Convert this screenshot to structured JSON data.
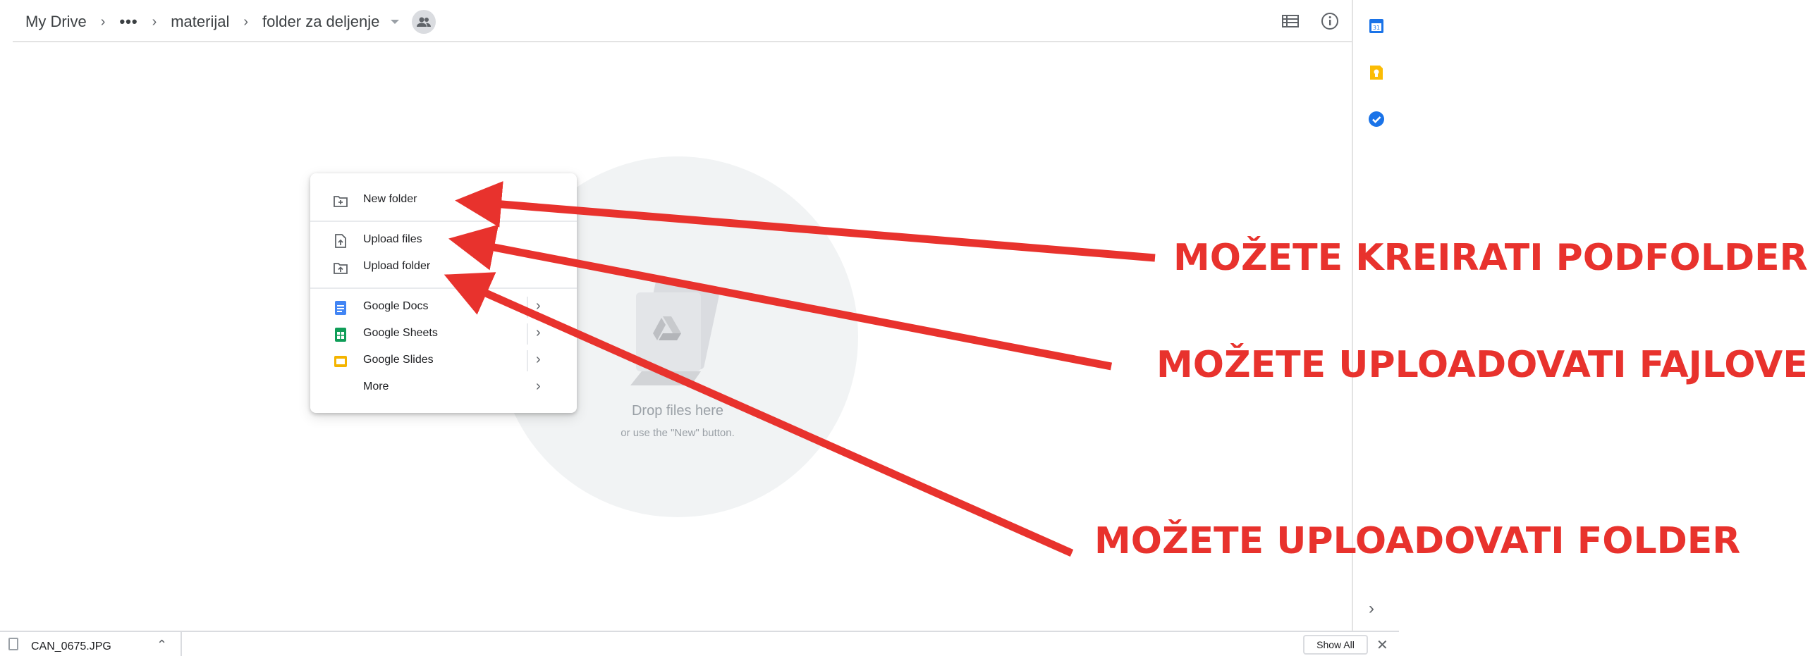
{
  "breadcrumb": {
    "root": "My Drive",
    "more": "•••",
    "folder1": "materijal",
    "current": "folder za deljenje"
  },
  "header_icons": [
    "list-view-icon",
    "info-icon"
  ],
  "side_panel_icons": [
    "calendar-icon",
    "keep-icon",
    "tasks-icon",
    "chevron-right-icon"
  ],
  "menu": {
    "new_folder": "New folder",
    "upload_files": "Upload files",
    "upload_folder": "Upload folder",
    "google_docs": "Google Docs",
    "google_sheets": "Google Sheets",
    "google_slides": "Google Slides",
    "more": "More"
  },
  "empty_state": {
    "title": "Drop files here",
    "subtitle": "or use the \"New\" button."
  },
  "annotations": {
    "subfolder": "MOŽETE KREIRATI PODFOLDER",
    "upload_files": "MOŽETE UPLOADOVATI FAJLOVE",
    "upload_folder": "MOŽETE UPLOADOVATI FOLDER"
  },
  "download_bar": {
    "file_name": "CAN_0675.JPG",
    "show_all": "Show All"
  },
  "colors": {
    "annotation_red": "#e8322d",
    "docs_blue": "#4285f4",
    "sheets_green": "#0f9d58",
    "slides_yellow": "#f4b400"
  }
}
